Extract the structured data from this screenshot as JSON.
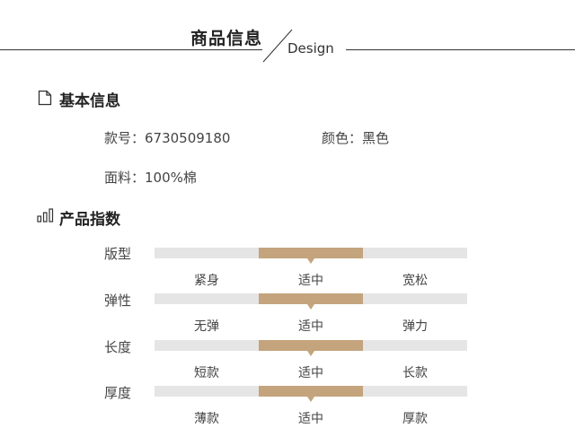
{
  "header": {
    "title": "商品信息",
    "subtitle": "Design"
  },
  "basic": {
    "title": "基本信息",
    "icon": "document-icon",
    "style_no": "款号：6730509180",
    "color": "颜色：黑色",
    "fabric": "面料：100%棉"
  },
  "index": {
    "title": "产品指数",
    "icon": "bar-chart-icon",
    "accent": "#c4a47c",
    "track": "#e5e5e5",
    "rows": [
      {
        "label": "版型",
        "options": [
          "紧身",
          "适中",
          "宽松"
        ],
        "selected": 1
      },
      {
        "label": "弹性",
        "options": [
          "无弹",
          "适中",
          "弹力"
        ],
        "selected": 1
      },
      {
        "label": "长度",
        "options": [
          "短款",
          "适中",
          "长款"
        ],
        "selected": 1
      },
      {
        "label": "厚度",
        "options": [
          "薄款",
          "适中",
          "厚款"
        ],
        "selected": 1
      }
    ]
  }
}
